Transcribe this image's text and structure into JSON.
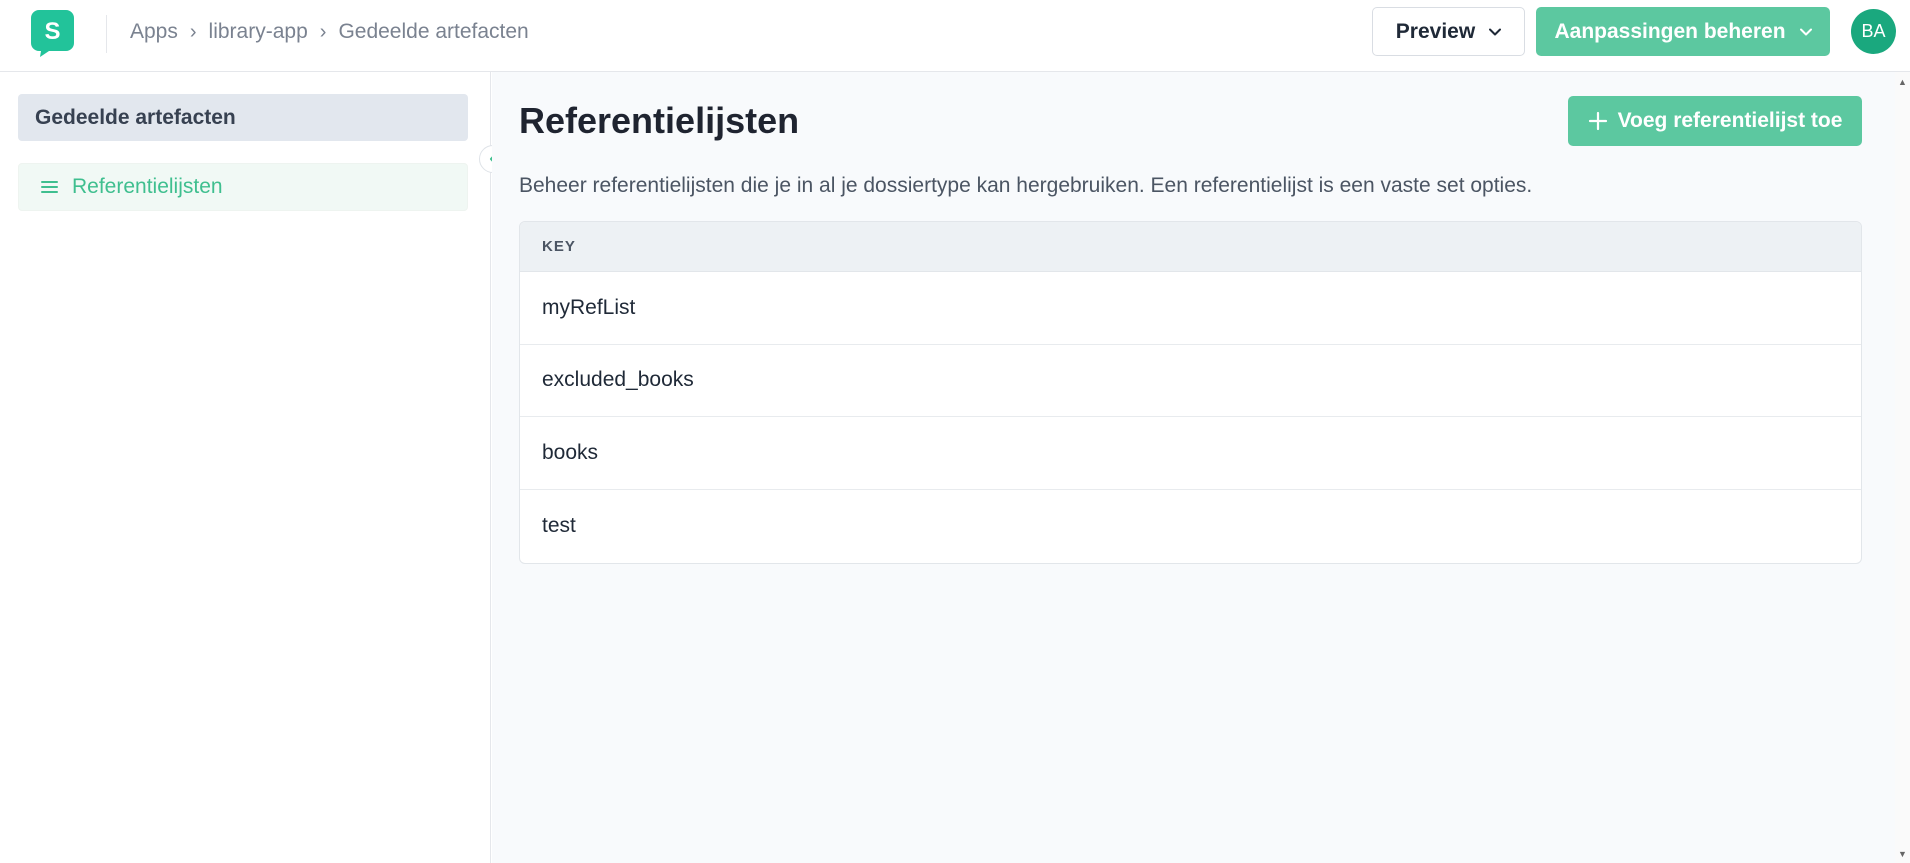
{
  "brand": {
    "logo_letter": "S",
    "accent_color": "#5cc8a0"
  },
  "breadcrumb": [
    "Apps",
    "library-app",
    "Gedeelde artefacten"
  ],
  "header": {
    "preview_label": "Preview",
    "manage_label": "Aanpassingen beheren",
    "avatar_initials": "BA"
  },
  "sidebar": {
    "section_title": "Gedeelde artefacten",
    "items": [
      {
        "label": "Referentielijsten",
        "icon": "list-icon"
      }
    ]
  },
  "main": {
    "title": "Referentielijsten",
    "add_button_label": "Voeg referentielijst toe",
    "description": "Beheer referentielijsten die je in al je dossiertype kan hergebruiken. Een referentielijst is een vaste set opties.",
    "table": {
      "header": "KEY",
      "rows": [
        "myRefList",
        "excluded_books",
        "books",
        "test"
      ]
    }
  }
}
